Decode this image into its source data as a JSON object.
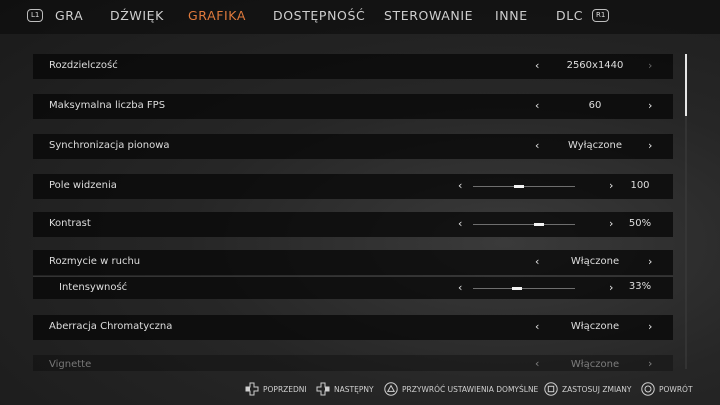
{
  "tabs": {
    "left_bumper": "L1",
    "right_bumper": "R1",
    "items": [
      {
        "label": "GRA",
        "active": false
      },
      {
        "label": "DŹWIĘK",
        "active": false
      },
      {
        "label": "GRAFIKA",
        "active": true
      },
      {
        "label": "DOSTĘPNOŚĆ",
        "active": false
      },
      {
        "label": "STEROWANIE",
        "active": false
      },
      {
        "label": "INNE",
        "active": false
      },
      {
        "label": "DLC",
        "active": false
      }
    ]
  },
  "settings": [
    {
      "label": "Rozdzielczość",
      "value": "2560x1440",
      "type": "select"
    },
    {
      "label": "Maksymalna liczba FPS",
      "value": "60",
      "type": "select"
    },
    {
      "label": "Synchronizacja pionowa",
      "value": "Wyłączone",
      "type": "select"
    },
    {
      "label": "Pole widzenia",
      "value": "100",
      "type": "slider",
      "level": 0.45
    },
    {
      "label": "Kontrast",
      "value": "50%",
      "type": "slider",
      "level": 0.65
    },
    {
      "label": "Rozmycie w ruchu",
      "value": "Włączone",
      "type": "select"
    },
    {
      "label": "Intensywność",
      "value": "33%",
      "type": "slider",
      "level": 0.43
    },
    {
      "label": "Aberracja Chromatyczna",
      "value": "Włączone",
      "type": "select"
    },
    {
      "label": "Vignette",
      "value": "Włączone",
      "type": "select"
    }
  ],
  "footer": {
    "previous": "POPRZEDNI",
    "next": "NASTĘPNY",
    "restore_defaults": "PRZYWRÓĆ USTAWIENIA DOMYŚLNE",
    "apply_changes": "ZASTOSUJ ZMIANY",
    "back": "POWRÓT"
  },
  "colors": {
    "accent": "#e07a3c",
    "row_background": "#080808"
  },
  "icons": {
    "previous": "dpad-left-icon",
    "next": "dpad-right-icon",
    "restore_defaults": "triangle-button-icon",
    "apply_changes": "square-button-icon",
    "back": "circle-button-icon"
  }
}
